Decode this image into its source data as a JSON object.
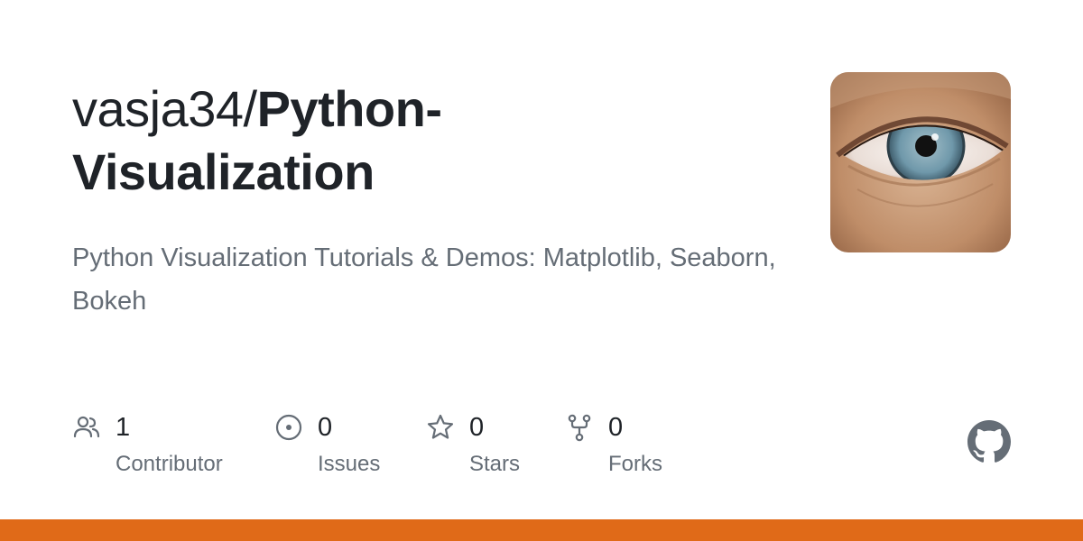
{
  "repo": {
    "owner": "vasja34/",
    "name": "Python-Visualization",
    "name_line1": "Python-",
    "name_line2": "Visualization",
    "description": "Python Visualization Tutorials & Demos: Matplotlib, Seaborn, Bokeh"
  },
  "avatar": {
    "icon": "eye-photo"
  },
  "stats": [
    {
      "icon": "people-icon",
      "value": "1",
      "label": "Contributor"
    },
    {
      "icon": "issue-icon",
      "value": "0",
      "label": "Issues"
    },
    {
      "icon": "star-icon",
      "value": "0",
      "label": "Stars"
    },
    {
      "icon": "fork-icon",
      "value": "0",
      "label": "Forks"
    }
  ],
  "brand": {
    "icon": "github-icon"
  },
  "colors": {
    "text": "#1f2328",
    "muted": "#656d76",
    "language_bar": "#e06a18"
  }
}
